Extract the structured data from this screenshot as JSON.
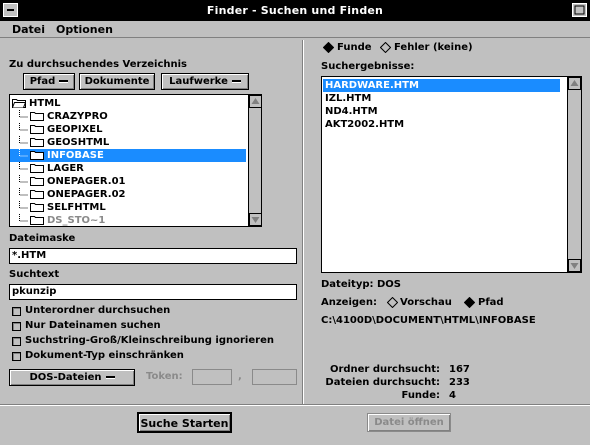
{
  "window": {
    "title": "Finder - Suchen und Finden"
  },
  "menu": {
    "file": "Datei",
    "options": "Optionen"
  },
  "left": {
    "dir_label": "Zu durchsuchendes Verzeichnis",
    "btn_path": "Pfad",
    "btn_documents": "Dokumente",
    "btn_drives": "Laufwerke",
    "tree": [
      {
        "label": "HTML",
        "level": 0,
        "selected": false
      },
      {
        "label": "CRAZYPRO",
        "level": 1,
        "selected": false
      },
      {
        "label": "GEOPIXEL",
        "level": 1,
        "selected": false
      },
      {
        "label": "GEOSHTML",
        "level": 1,
        "selected": false
      },
      {
        "label": "INFOBASE",
        "level": 1,
        "selected": true
      },
      {
        "label": "LAGER",
        "level": 1,
        "selected": false
      },
      {
        "label": "ONEPAGER.01",
        "level": 1,
        "selected": false
      },
      {
        "label": "ONEPAGER.02",
        "level": 1,
        "selected": false
      },
      {
        "label": "SELFHTML",
        "level": 1,
        "selected": false
      },
      {
        "label": "DS_STO~1",
        "level": 1,
        "selected": false
      }
    ],
    "mask_label": "Dateimaske",
    "mask_value": "*.HTM",
    "search_label": "Suchtext",
    "search_value": "pkunzip",
    "opt_subfolders": "Unterordner durchsuchen",
    "opt_names_only": "Nur Dateinamen suchen",
    "opt_case": "Suchstring-Groß/Kleinschreibung ignorieren",
    "opt_doctype": "Dokument-Typ einschränken",
    "doctype_btn": "DOS-Dateien",
    "token_label": "Token:",
    "token_sep": ","
  },
  "right": {
    "radio_found": "Funde",
    "radio_errors": "Fehler (keine)",
    "results_label": "Suchergebnisse:",
    "results": [
      "HARDWARE.HTM",
      "IZL.HTM",
      "ND4.HTM",
      "AKT2002.HTM"
    ],
    "filetype": "Dateityp: DOS",
    "show_label": "Anzeigen:",
    "show_preview": "Vorschau",
    "show_path": "Pfad",
    "path_value": "C:\\4100D\\DOCUMENT\\HTML\\INFOBASE",
    "stats": {
      "folders_label": "Ordner durchsucht:",
      "folders_value": "167",
      "files_label": "Dateien durchsucht:",
      "files_value": "233",
      "found_label": "Funde:",
      "found_value": "4"
    }
  },
  "footer": {
    "start": "Suche Starten",
    "open": "Datei öffnen"
  }
}
